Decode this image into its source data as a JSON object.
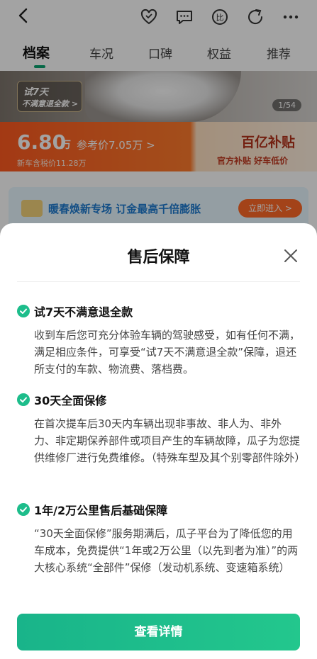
{
  "tabs": [
    {
      "label": "档案",
      "active": true
    },
    {
      "label": "车况",
      "active": false
    },
    {
      "label": "口碑",
      "active": false
    },
    {
      "label": "权益",
      "active": false
    },
    {
      "label": "推荐",
      "active": false
    }
  ],
  "hero": {
    "trial_badge_line1": "试7天",
    "trial_badge_line2": "不满意退全款 >",
    "page_counter": "1/54"
  },
  "price": {
    "main": "6.80",
    "unit": "万",
    "reference": "参考价7.05万 >",
    "new_car_tax": "新车含税价11.28万",
    "subsidy_title": "百亿补贴",
    "subsidy_sub": "官方补贴 好车低价"
  },
  "promo": {
    "text": "暖春焕新专场  订金最高千倍膨胀",
    "button": "立即进入 >"
  },
  "sheet": {
    "title": "售后保障",
    "sections": [
      {
        "title": "试7天不满意退全款",
        "body": "收到车后您可充分体验车辆的驾驶感受，如有任何不满，满足相应条件，可享受“试7天不满意退全款”保障，退还所支付的车款、物流费、落档费。"
      },
      {
        "title": "30天全面保修",
        "body": "在首次提车后30天内车辆出现非事故、非人为、非外力、非定期保养部件或项目产生的车辆故障，瓜子为您提供维修厂进行免费维修。（特殊车型及其个别零部件除外）"
      },
      {
        "title": "1年/2万公里售后基础保障",
        "body": "“30天全面保修”服务期满后，瓜子平台为了降低您的用车成本，免费提供“1年或2万公里（以先到者为准）”的两大核心系统“全部件”保修（发动机系统、变速箱系统）"
      }
    ],
    "cta": "查看详情"
  },
  "colors": {
    "accent_green": "#1dbd8b",
    "price_orange": "#ff5a20"
  }
}
